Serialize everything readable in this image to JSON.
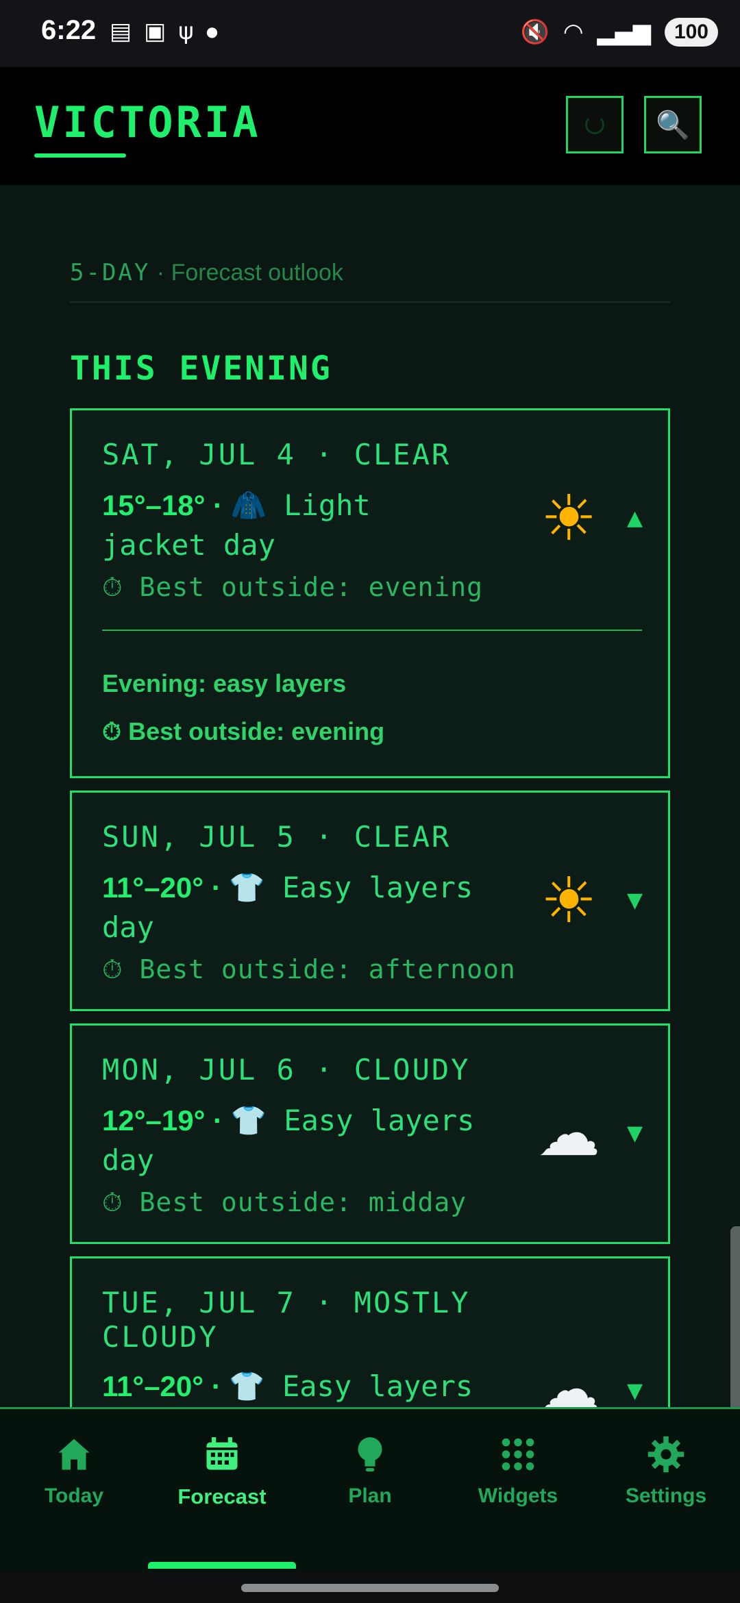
{
  "status_bar": {
    "time": "6:22",
    "battery": "100",
    "left_icons": [
      "stack-icon",
      "chat-icon",
      "usb-icon",
      "dot-icon"
    ],
    "right_icons": [
      "mute-icon",
      "wifi-icon",
      "signal-icon"
    ]
  },
  "header": {
    "city": "VICTORIA",
    "buttons": [
      "refresh-icon",
      "search-icon"
    ]
  },
  "section": {
    "title": "5-DAY",
    "subtitle": " · Forecast outlook",
    "evening_heading": "THIS EVENING"
  },
  "days": [
    {
      "day": "SAT, JUL 4 · CLEAR",
      "temps": "15°–18°",
      "separator": " · ",
      "clothing_icon": "🧥",
      "clothing_text": " Light jacket day",
      "best": "⏱ Best outside: evening",
      "weather_icon": "sun-icon",
      "weather_glyph": "☀",
      "chevron": "▲",
      "expanded": true,
      "details": [
        "Evening: easy layers",
        "⏱ Best outside: evening"
      ]
    },
    {
      "day": "SUN, JUL 5 · CLEAR",
      "temps": "11°–20°",
      "separator": " · ",
      "clothing_icon": "👕",
      "clothing_text": " Easy layers day",
      "best": "⏱ Best outside: afternoon",
      "weather_icon": "sun-icon",
      "weather_glyph": "☀",
      "chevron": "▼",
      "expanded": false
    },
    {
      "day": "MON, JUL 6 · CLOUDY",
      "temps": "12°–19°",
      "separator": " · ",
      "clothing_icon": "👕",
      "clothing_text": " Easy layers day",
      "best": "⏱ Best outside: midday",
      "weather_icon": "cloud-icon",
      "weather_glyph": "☁",
      "chevron": "▼",
      "expanded": false
    },
    {
      "day": "TUE, JUL 7 · MOSTLY CLOUDY",
      "temps": "11°–20°",
      "separator": " · ",
      "clothing_icon": "👕",
      "clothing_text": " Easy layers",
      "weather_icon": "cloud-icon",
      "weather_glyph": "☁",
      "chevron": "▼",
      "expanded": false
    }
  ],
  "nav": {
    "items": [
      {
        "label": "Today",
        "icon": "home-icon"
      },
      {
        "label": "Forecast",
        "icon": "calendar-icon",
        "active": true
      },
      {
        "label": "Plan",
        "icon": "lightbulb-icon"
      },
      {
        "label": "Widgets",
        "icon": "grid-icon"
      },
      {
        "label": "Settings",
        "icon": "gear-icon"
      }
    ]
  },
  "colors": {
    "accent": "#1ff06b",
    "background": "#0b1713",
    "card_bg": "#0c1d17",
    "header_bg": "#000000"
  }
}
